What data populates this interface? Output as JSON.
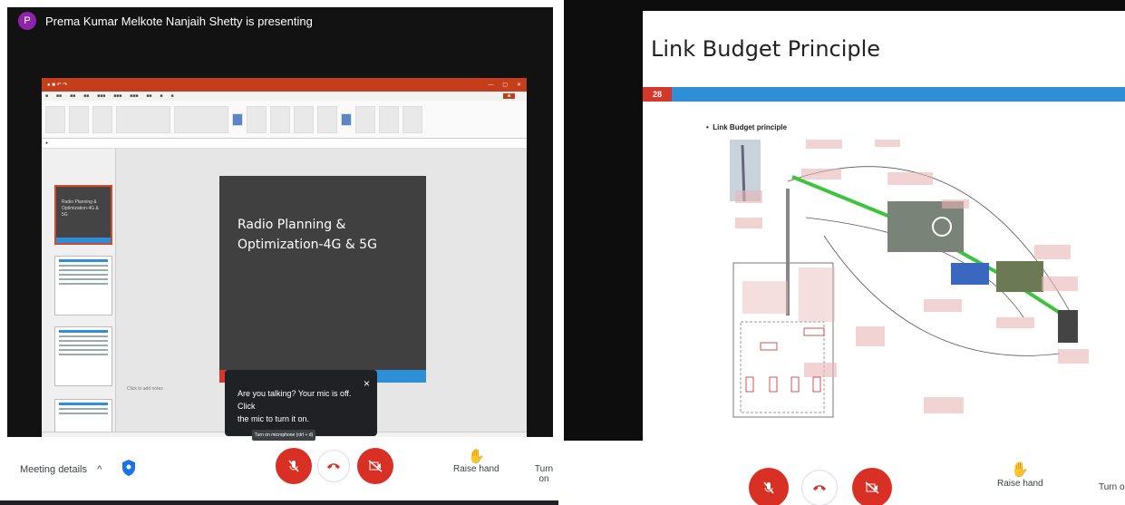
{
  "left": {
    "presenter": {
      "initial": "P",
      "text": "Prema Kumar Melkote Nanjaih Shetty is presenting"
    },
    "ppt": {
      "slide_text_line1": "Radio Planning &",
      "slide_text_line2": "Optimization-4G & 5G",
      "thumb1_text": "Radio Planning & Optimization-4G & 5G",
      "notes_placeholder": "Click to add notes"
    },
    "mic_prompt": {
      "line1": "Are you talking? Your mic is off. Click",
      "line2": "the mic to turn it on.",
      "close": "×"
    },
    "mic_hint": "Turn on microphone (ctrl + d)",
    "controls": {
      "meeting_details": "Meeting details",
      "chevron": "^",
      "raise_hand": "Raise hand",
      "turn_on": "Turn on"
    }
  },
  "right": {
    "slide": {
      "title": "Link Budget Principle",
      "number": "28",
      "bullet": "Link Budget principle"
    },
    "controls": {
      "raise_hand": "Raise hand",
      "turn_on": "Turn o"
    }
  },
  "colors": {
    "red": "#d93025",
    "ppt_orange": "#c43e1c",
    "accent_blue": "#2e8fd6",
    "purple_avatar": "#8e24aa"
  }
}
